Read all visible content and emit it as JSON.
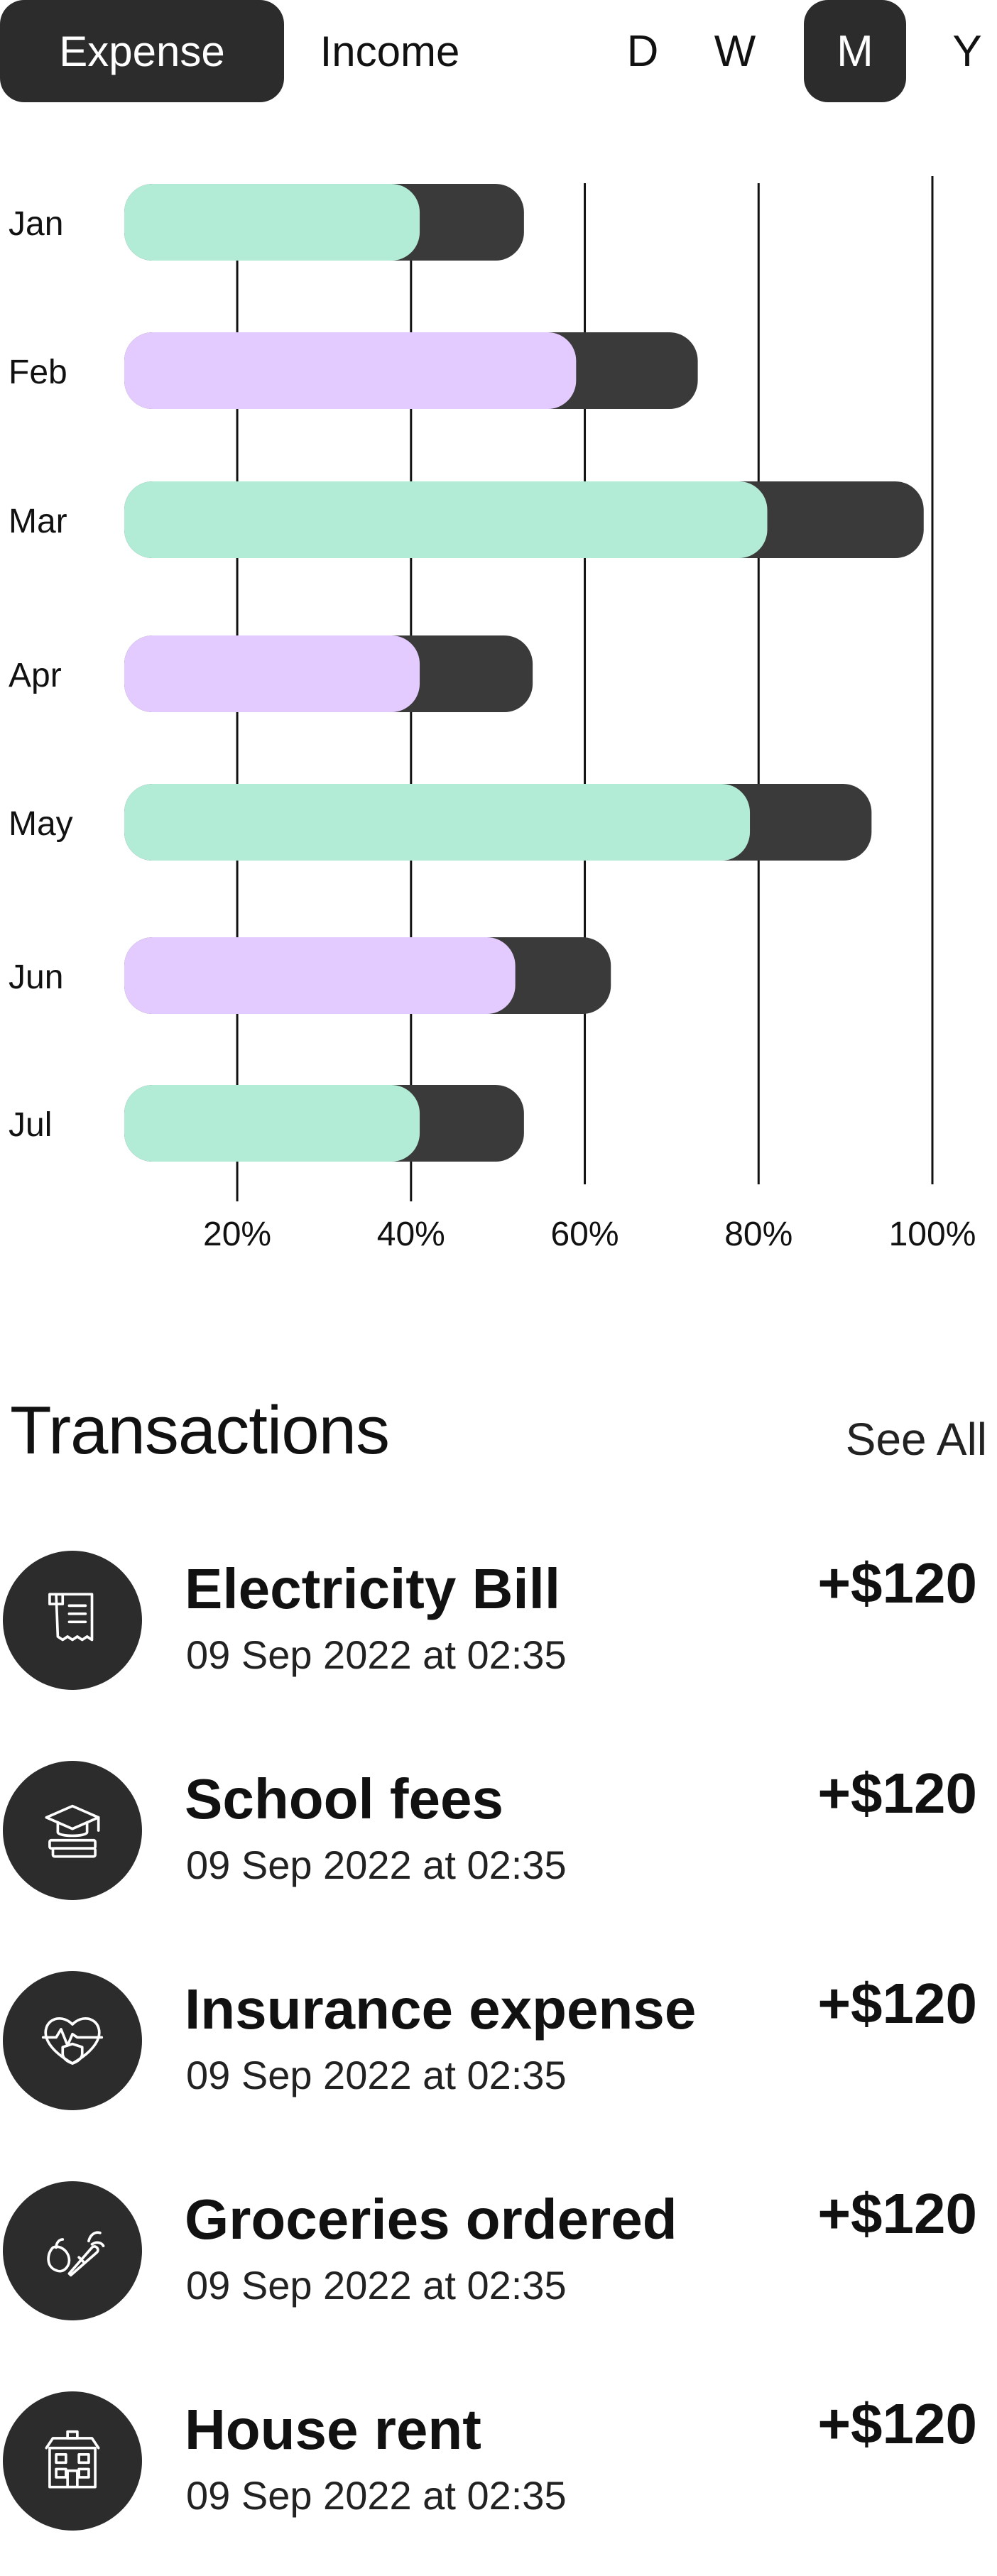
{
  "toggle": {
    "expense_label": "Expense",
    "income_label": "Income",
    "active": "Expense"
  },
  "periods": {
    "items": [
      "D",
      "W",
      "M",
      "Y"
    ],
    "active": "M"
  },
  "colors": {
    "accent_green": "#b3ecd6",
    "accent_purple": "#e3cbff",
    "dark": "#3a3a3a",
    "icon_bg": "#2c2c2c"
  },
  "chart_data": {
    "type": "bar",
    "orientation": "horizontal",
    "stacked": true,
    "categories": [
      "Jan",
      "Feb",
      "Mar",
      "Apr",
      "May",
      "Jun",
      "Jul"
    ],
    "series": [
      {
        "values": [
          34,
          52,
          74,
          34,
          72,
          45,
          34
        ]
      },
      {
        "values": [
          12,
          14,
          18,
          13,
          14,
          11,
          12
        ]
      }
    ],
    "bar_colors": [
      "#b3ecd6",
      "#e3cbff",
      "#b3ecd6",
      "#e3cbff",
      "#b3ecd6",
      "#e3cbff",
      "#b3ecd6"
    ],
    "xticks": [
      "20%",
      "40%",
      "60%",
      "80%",
      "100%"
    ],
    "xtick_values": [
      20,
      40,
      60,
      80,
      100
    ],
    "xlim": [
      7,
      100
    ],
    "grid": true
  },
  "transactions": {
    "title": "Transactions",
    "see_all": "See All",
    "items": [
      {
        "name": "Electricity Bill",
        "date": "09 Sep 2022 at 02:35",
        "amount": "+$120",
        "icon": "receipt-icon"
      },
      {
        "name": "School fees",
        "date": "09 Sep 2022 at 02:35",
        "amount": "+$120",
        "icon": "graduation-cap-icon"
      },
      {
        "name": "Insurance expense",
        "date": "09 Sep 2022 at 02:35",
        "amount": "+$120",
        "icon": "heart-shield-icon"
      },
      {
        "name": "Groceries ordered",
        "date": "09 Sep 2022 at 02:35",
        "amount": "+$120",
        "icon": "vegetables-icon"
      },
      {
        "name": "House rent",
        "date": "09 Sep 2022 at 02:35",
        "amount": "+$120",
        "icon": "house-icon"
      }
    ]
  }
}
